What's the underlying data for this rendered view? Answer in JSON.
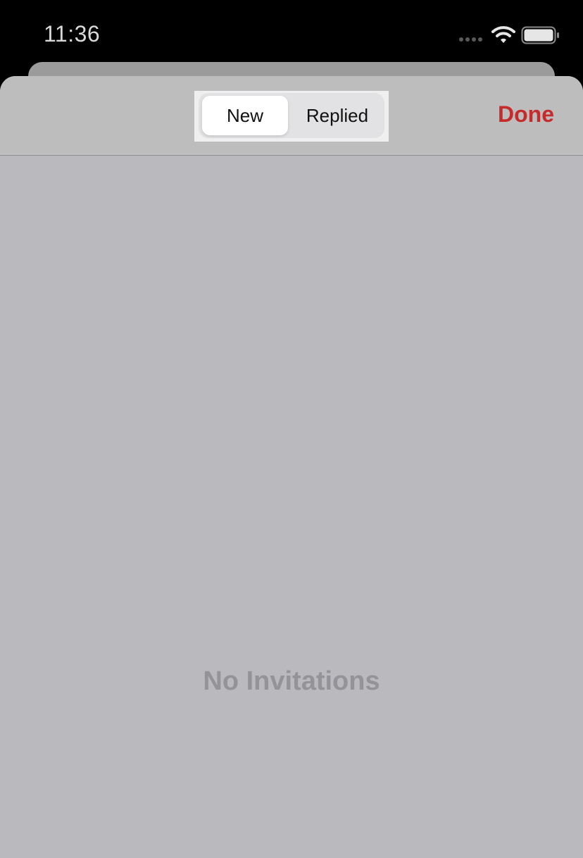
{
  "status_bar": {
    "time": "11:36",
    "icons": [
      "cellular-signal-icon",
      "wifi-icon",
      "battery-icon"
    ]
  },
  "nav": {
    "segments": [
      {
        "label": "New",
        "selected": true
      },
      {
        "label": "Replied",
        "selected": false
      }
    ],
    "done_label": "Done"
  },
  "content": {
    "empty_message": "No Invitations"
  },
  "colors": {
    "accent": "#c62a2a",
    "sheet_background": "#bab9be",
    "empty_text": "#949398"
  }
}
